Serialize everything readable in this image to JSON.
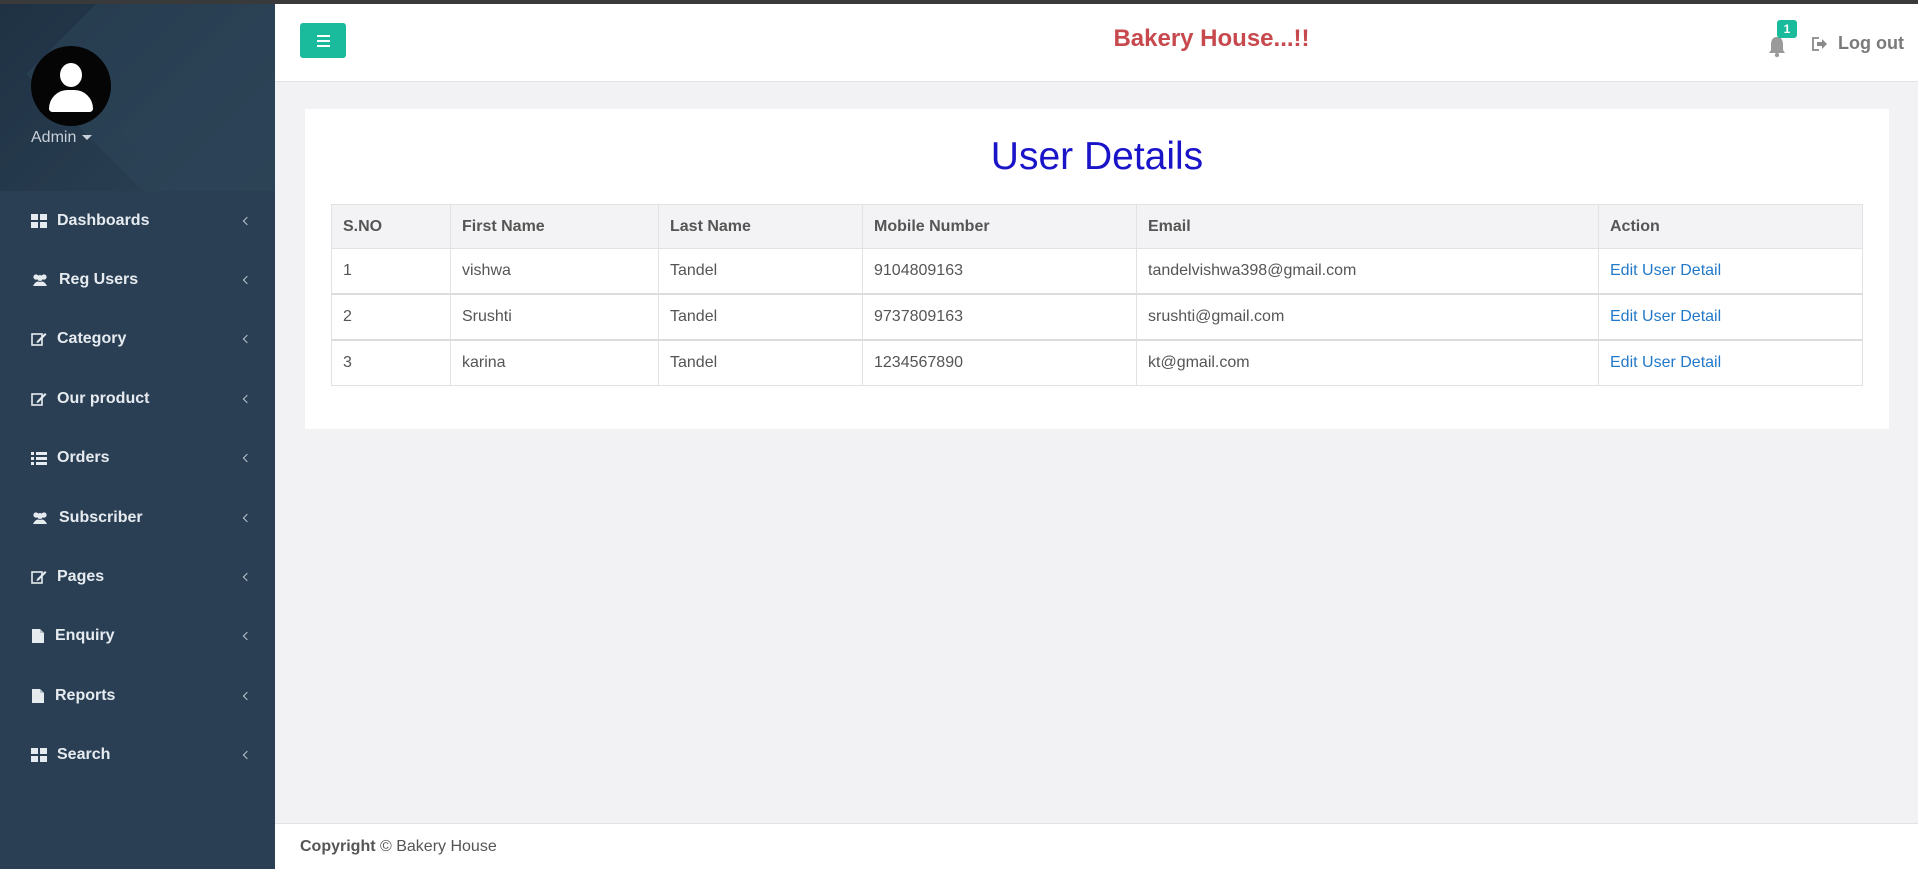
{
  "app": {
    "brand": "Bakery House...!!"
  },
  "user": {
    "name": "Admin"
  },
  "sidebar": {
    "items": [
      {
        "label": "Dashboards",
        "icon": "dashboard-icon"
      },
      {
        "label": "Reg Users",
        "icon": "users-icon"
      },
      {
        "label": "Category",
        "icon": "edit-icon"
      },
      {
        "label": "Our product",
        "icon": "edit-icon"
      },
      {
        "label": "Orders",
        "icon": "list-icon"
      },
      {
        "label": "Subscriber",
        "icon": "users-icon"
      },
      {
        "label": "Pages",
        "icon": "edit-icon"
      },
      {
        "label": "Enquiry",
        "icon": "file-icon"
      },
      {
        "label": "Reports",
        "icon": "file-icon"
      },
      {
        "label": "Search",
        "icon": "dashboard-icon"
      }
    ]
  },
  "header": {
    "notifications_count": "1",
    "logout_label": "Log out"
  },
  "main": {
    "title": "User Details",
    "table": {
      "columns": [
        "S.NO",
        "First Name",
        "Last Name",
        "Mobile Number",
        "Email",
        "Action"
      ],
      "rows": [
        [
          "1",
          "vishwa",
          "Tandel",
          "9104809163",
          "tandelvishwa398@gmail.com",
          "Edit User Detail"
        ],
        [
          "2",
          "Srushti",
          "Tandel",
          "9737809163",
          "srushti@gmail.com",
          "Edit User Detail"
        ],
        [
          "3",
          "karina",
          "Tandel",
          "1234567890",
          "kt@gmail.com",
          "Edit User Detail"
        ]
      ]
    }
  },
  "footer": {
    "copyright_bold": "Copyright",
    "copyright_rest": " © Bakery House"
  },
  "colors": {
    "sidebar": "#2a3f54",
    "accent": "#1abb9c",
    "brand": "#c7494d",
    "title": "#1a14c9",
    "link": "#2279c9"
  }
}
